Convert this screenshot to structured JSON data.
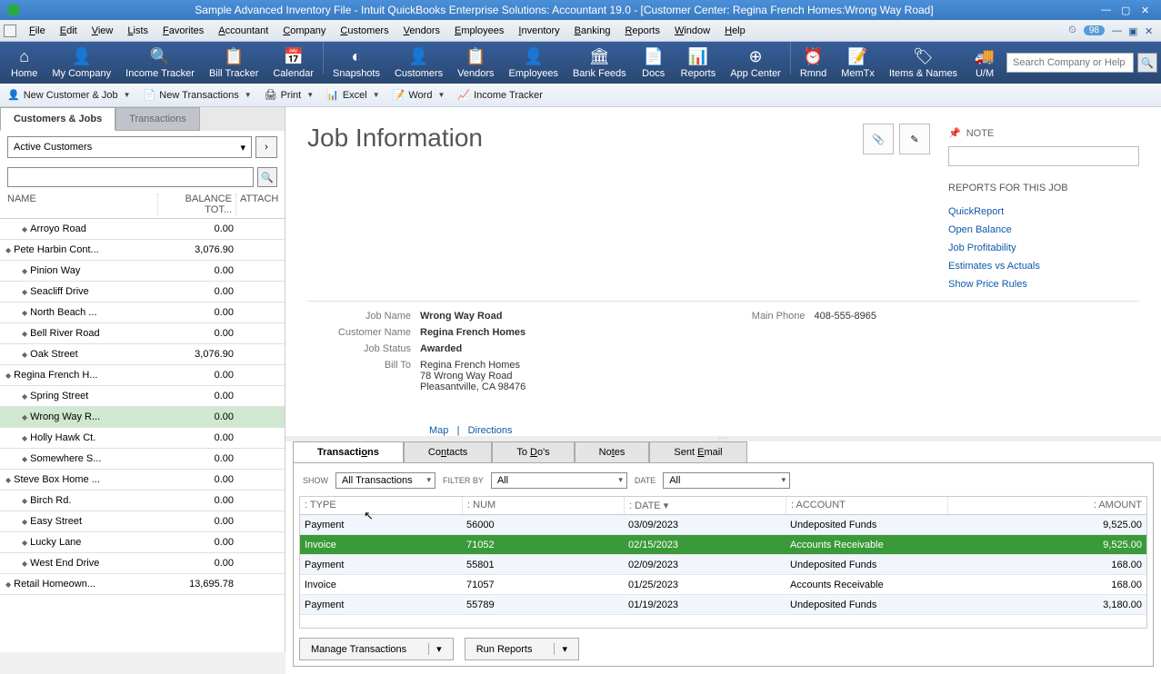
{
  "title": "Sample Advanced Inventory File  - Intuit QuickBooks Enterprise Solutions: Accountant 19.0 - [Customer Center: Regina French Homes:Wrong Way Road]",
  "menu": [
    "File",
    "Edit",
    "View",
    "Lists",
    "Favorites",
    "Accountant",
    "Company",
    "Customers",
    "Vendors",
    "Employees",
    "Inventory",
    "Banking",
    "Reports",
    "Window",
    "Help"
  ],
  "badge": "98",
  "toolbar": [
    {
      "label": "Home",
      "icon": "⌂"
    },
    {
      "label": "My Company",
      "icon": "👤"
    },
    {
      "label": "Income Tracker",
      "icon": "🔍"
    },
    {
      "label": "Bill Tracker",
      "icon": "📋"
    },
    {
      "label": "Calendar",
      "icon": "📅"
    },
    {
      "label": "Snapshots",
      "icon": "◐"
    },
    {
      "label": "Customers",
      "icon": "👤"
    },
    {
      "label": "Vendors",
      "icon": "📋"
    },
    {
      "label": "Employees",
      "icon": "👤"
    },
    {
      "label": "Bank Feeds",
      "icon": "🏛"
    },
    {
      "label": "Docs",
      "icon": "📄"
    },
    {
      "label": "Reports",
      "icon": "📊"
    },
    {
      "label": "App Center",
      "icon": "⊕"
    },
    {
      "label": "Rmnd",
      "icon": "⏰"
    },
    {
      "label": "MemTx",
      "icon": "📝"
    },
    {
      "label": "Items & Names",
      "icon": "🏷"
    },
    {
      "label": "U/M",
      "icon": "🚚"
    }
  ],
  "search_placeholder": "Search Company or Help",
  "actions": {
    "new_customer": "New Customer & Job",
    "new_trans": "New Transactions",
    "print": "Print",
    "excel": "Excel",
    "word": "Word",
    "income": "Income Tracker"
  },
  "left": {
    "tabs": {
      "cust": "Customers & Jobs",
      "trans": "Transactions"
    },
    "filter": "Active Customers",
    "header": {
      "name": "NAME",
      "bal": "BALANCE TOT...",
      "attach": "ATTACH"
    },
    "rows": [
      {
        "name": "Arroyo Road",
        "bal": "0.00",
        "child": true
      },
      {
        "name": "Pete Harbin Cont...",
        "bal": "3,076.90",
        "child": false
      },
      {
        "name": "Pinion Way",
        "bal": "0.00",
        "child": true
      },
      {
        "name": "Seacliff Drive",
        "bal": "0.00",
        "child": true
      },
      {
        "name": "North Beach ...",
        "bal": "0.00",
        "child": true
      },
      {
        "name": "Bell River Road",
        "bal": "0.00",
        "child": true
      },
      {
        "name": "Oak Street",
        "bal": "3,076.90",
        "child": true
      },
      {
        "name": "Regina French H...",
        "bal": "0.00",
        "child": false
      },
      {
        "name": "Spring Street",
        "bal": "0.00",
        "child": true
      },
      {
        "name": "Wrong Way R...",
        "bal": "0.00",
        "child": true,
        "selected": true
      },
      {
        "name": "Holly Hawk Ct.",
        "bal": "0.00",
        "child": true
      },
      {
        "name": "Somewhere S...",
        "bal": "0.00",
        "child": true
      },
      {
        "name": "Steve Box Home ...",
        "bal": "0.00",
        "child": false
      },
      {
        "name": "Birch Rd.",
        "bal": "0.00",
        "child": true
      },
      {
        "name": "Easy Street",
        "bal": "0.00",
        "child": true
      },
      {
        "name": "Lucky Lane",
        "bal": "0.00",
        "child": true
      },
      {
        "name": "West End Drive",
        "bal": "0.00",
        "child": true
      },
      {
        "name": "Retail Homeown...",
        "bal": "13,695.78",
        "child": false
      }
    ]
  },
  "job": {
    "title": "Job Information",
    "name_label": "Job Name",
    "name": "Wrong Way Road",
    "cust_label": "Customer Name",
    "cust": "Regina French Homes",
    "status_label": "Job Status",
    "status": "Awarded",
    "billto_label": "Bill To",
    "billto1": "Regina French Homes",
    "billto2": "78 Wrong Way Road",
    "billto3": "Pleasantville, CA 98476",
    "phone_label": "Main Phone",
    "phone": "408-555-8965",
    "map": "Map",
    "directions": "Directions"
  },
  "note": {
    "title": "NOTE",
    "reports": "REPORTS FOR THIS JOB",
    "links": [
      "QuickReport",
      "Open Balance",
      "Job Profitability",
      "Estimates vs Actuals",
      "Show Price Rules"
    ]
  },
  "sub_tabs": [
    "Transactions",
    "Contacts",
    "To Do's",
    "Notes",
    "Sent Email"
  ],
  "filters": {
    "show_label": "SHOW",
    "show": "All Transactions",
    "filter_label": "FILTER BY",
    "filter": "All",
    "date_label": "DATE",
    "date": "All"
  },
  "trans_head": {
    "type": "TYPE",
    "num": "NUM",
    "date": "DATE  ▾",
    "acct": "ACCOUNT",
    "amt": "AMOUNT"
  },
  "trans": [
    {
      "type": "Payment",
      "num": "56000",
      "date": "03/09/2023",
      "acct": "Undeposited Funds",
      "amt": "9,525.00"
    },
    {
      "type": "Invoice",
      "num": "71052",
      "date": "02/15/2023",
      "acct": "Accounts Receivable",
      "amt": "9,525.00",
      "selected": true
    },
    {
      "type": "Payment",
      "num": "55801",
      "date": "02/09/2023",
      "acct": "Undeposited Funds",
      "amt": "168.00"
    },
    {
      "type": "Invoice",
      "num": "71057",
      "date": "01/25/2023",
      "acct": "Accounts Receivable",
      "amt": "168.00"
    },
    {
      "type": "Payment",
      "num": "55789",
      "date": "01/19/2023",
      "acct": "Undeposited Funds",
      "amt": "3,180.00"
    }
  ],
  "footer_btns": {
    "manage": "Manage Transactions",
    "run": "Run Reports"
  }
}
